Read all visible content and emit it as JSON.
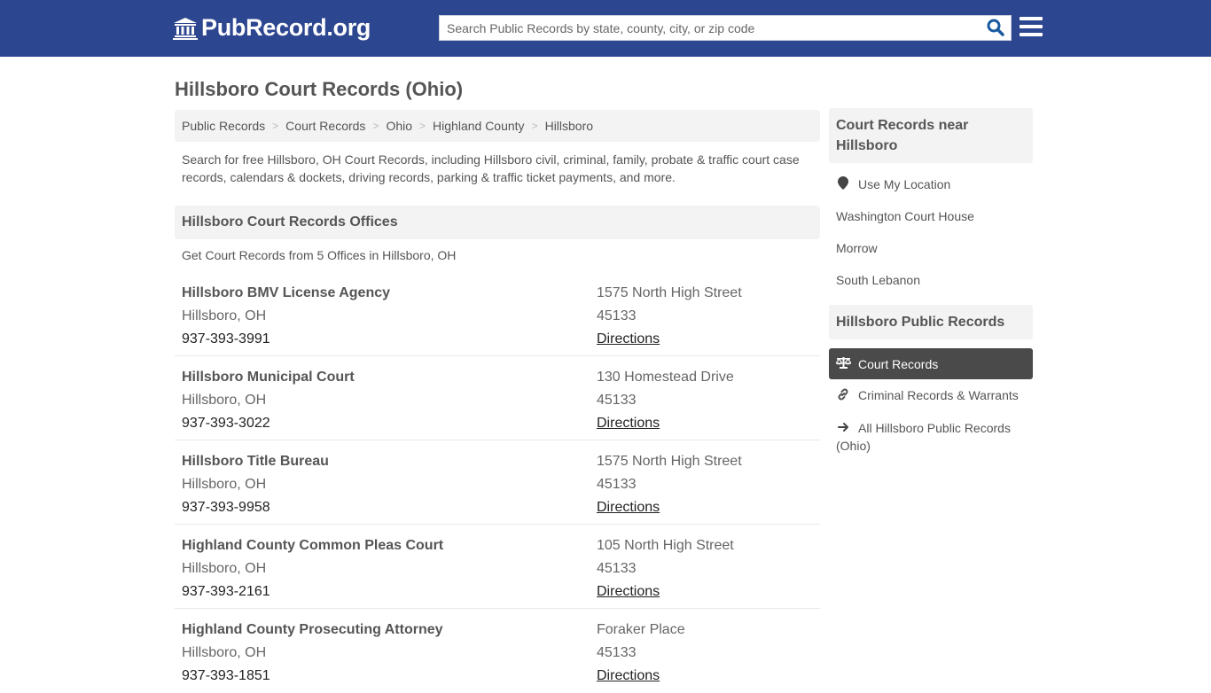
{
  "header": {
    "logo_text": "PubRecord.org",
    "search_placeholder": "Search Public Records by state, county, city, or zip code"
  },
  "page": {
    "title": "Hillsboro Court Records (Ohio)"
  },
  "breadcrumb": [
    "Public Records",
    "Court Records",
    "Ohio",
    "Highland County",
    "Hillsboro"
  ],
  "intro": "Search for free Hillsboro, OH Court Records, including Hillsboro civil, criminal, family, probate & traffic court case records, calendars & dockets, driving records, parking & traffic ticket payments, and more.",
  "offices_section": {
    "title": "Hillsboro Court Records Offices",
    "subtitle": "Get Court Records from 5 Offices in Hillsboro, OH",
    "offices": [
      {
        "name": "Hillsboro BMV License Agency",
        "city": "Hillsboro, OH",
        "phone": "937-393-3991",
        "address": "1575 North High Street",
        "zip": "45133",
        "directions": "Directions"
      },
      {
        "name": "Hillsboro Municipal Court",
        "city": "Hillsboro, OH",
        "phone": "937-393-3022",
        "address": "130 Homestead Drive",
        "zip": "45133",
        "directions": "Directions"
      },
      {
        "name": "Hillsboro Title Bureau",
        "city": "Hillsboro, OH",
        "phone": "937-393-9958",
        "address": "1575 North High Street",
        "zip": "45133",
        "directions": "Directions"
      },
      {
        "name": "Highland County Common Pleas Court",
        "city": "Hillsboro, OH",
        "phone": "937-393-2161",
        "address": "105 North High Street",
        "zip": "45133",
        "directions": "Directions"
      },
      {
        "name": "Highland County Prosecuting Attorney",
        "city": "Hillsboro, OH",
        "phone": "937-393-1851",
        "address": "Foraker Place",
        "zip": "45133",
        "directions": "Directions"
      }
    ]
  },
  "sidebar": {
    "nearby": {
      "title": "Court Records near Hillsboro",
      "use_location": "Use My Location",
      "places": [
        "Washington Court House",
        "Morrow",
        "South Lebanon"
      ]
    },
    "public_records": {
      "title": "Hillsboro Public Records",
      "items": [
        {
          "label": "Court Records",
          "icon": "balance-scale-icon",
          "active": true
        },
        {
          "label": "Criminal Records & Warrants",
          "icon": "link-icon",
          "active": false
        },
        {
          "label": "All Hillsboro Public Records (Ohio)",
          "icon": "arrow-right-icon",
          "active": false
        }
      ]
    }
  },
  "colors": {
    "navbar": "#2d4690",
    "search_icon": "#1a5aa0",
    "active_item": "#4a4a4a",
    "panel_bg": "#f3f3f3"
  }
}
